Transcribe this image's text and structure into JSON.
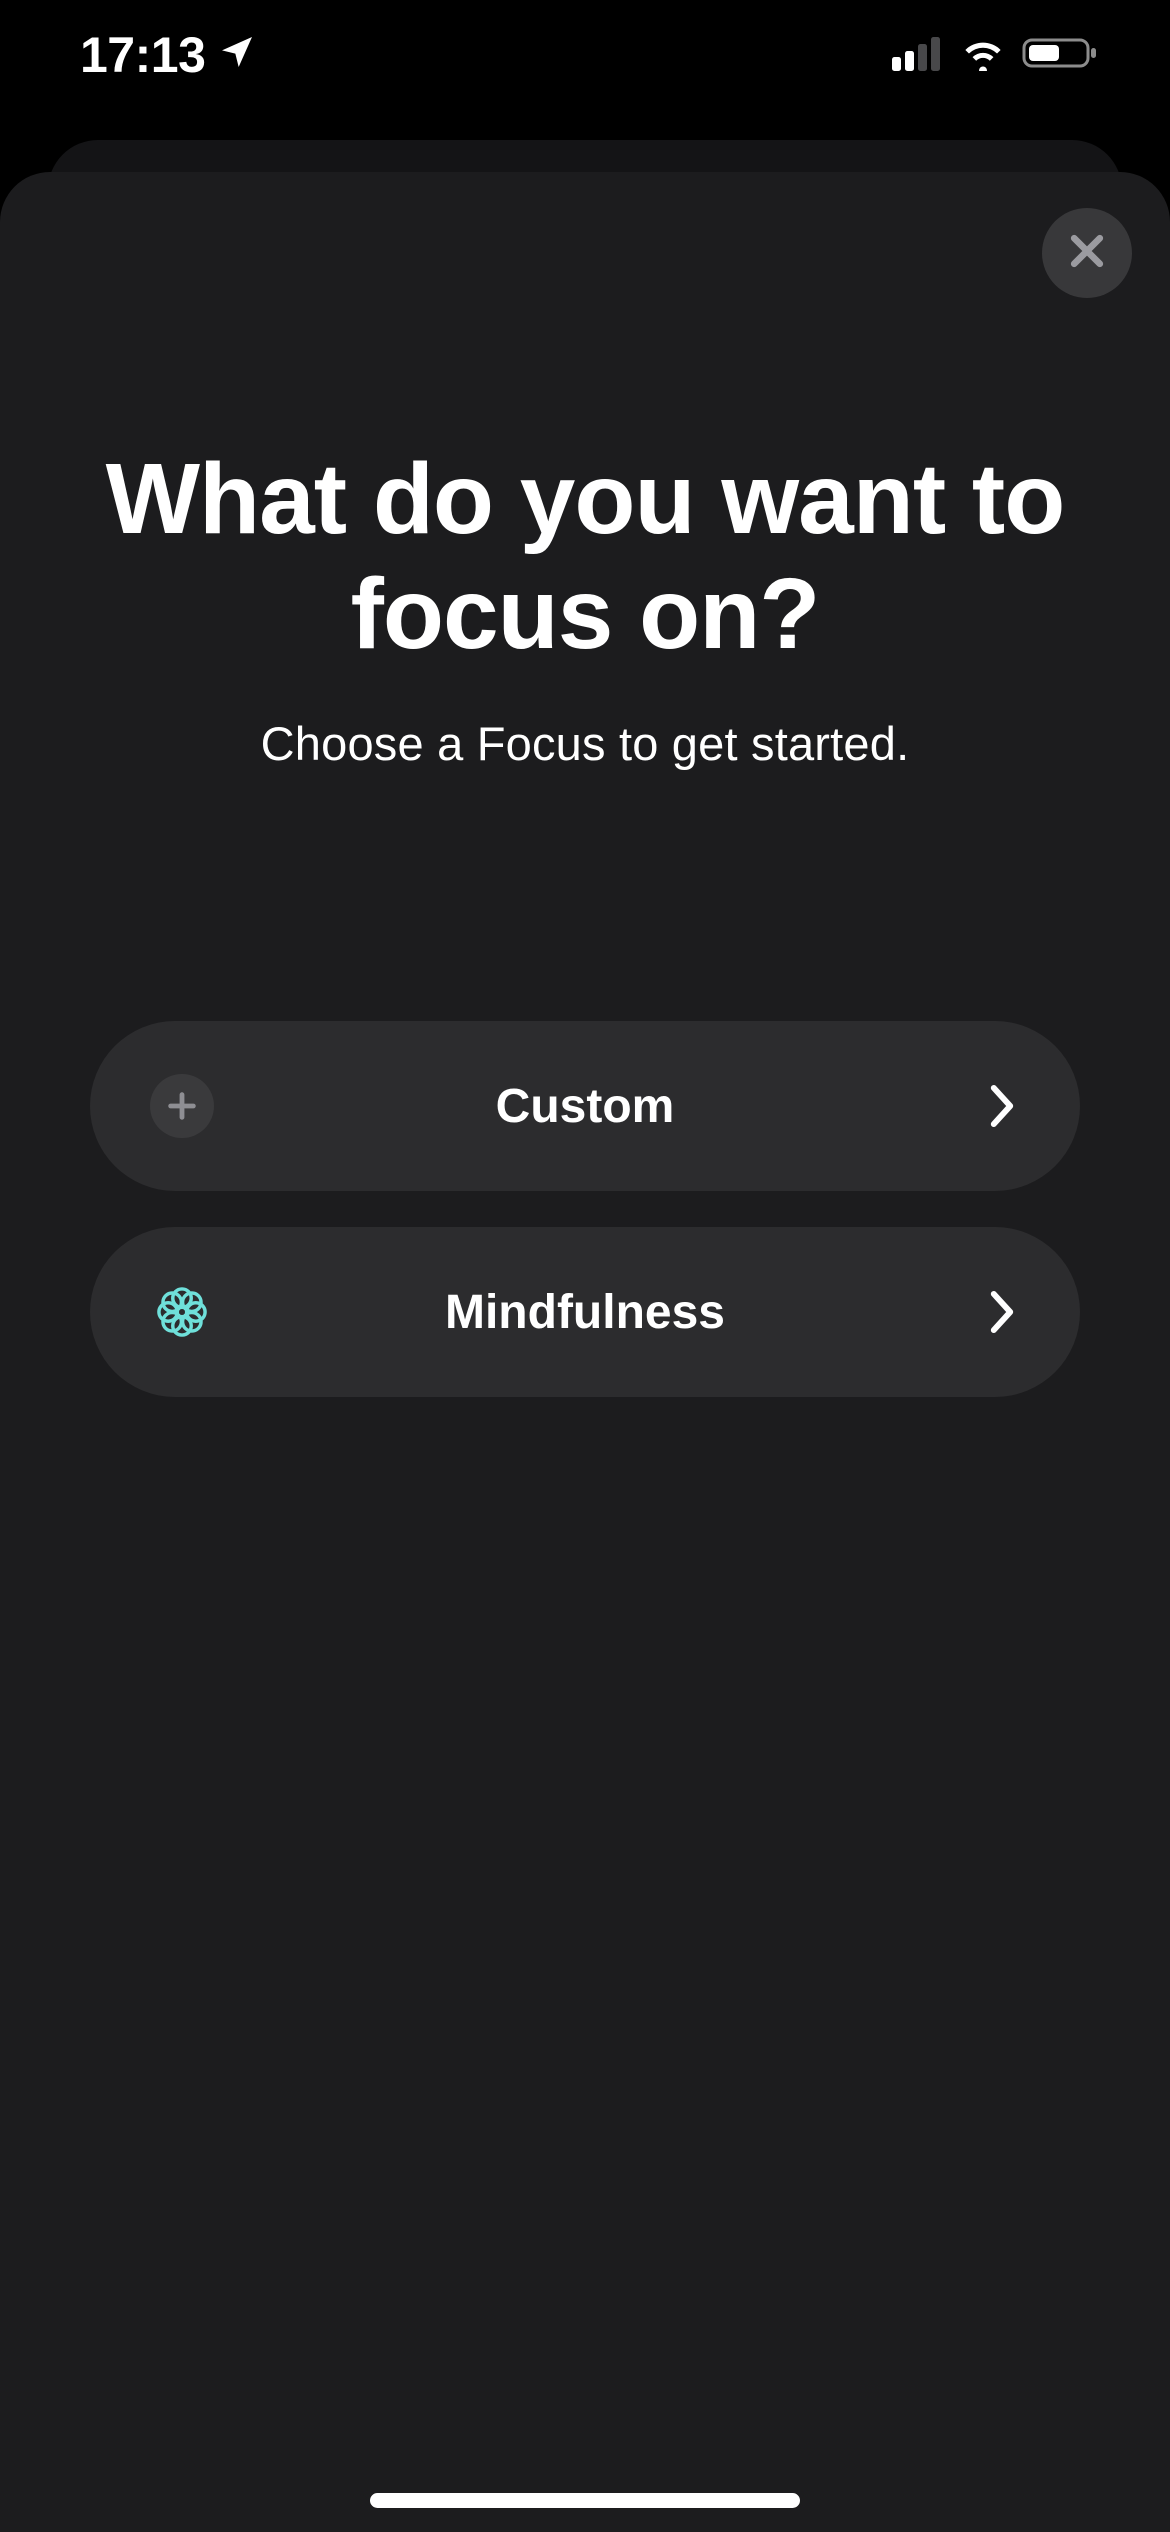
{
  "status_bar": {
    "time": "17:13"
  },
  "sheet": {
    "title": "What do you want to focus on?",
    "subtitle": "Choose a Focus to get started."
  },
  "options": [
    {
      "icon": "plus",
      "label": "Custom",
      "icon_color": "#8e8e93"
    },
    {
      "icon": "mindfulness",
      "label": "Mindfulness",
      "icon_color": "#6fe0da"
    }
  ]
}
